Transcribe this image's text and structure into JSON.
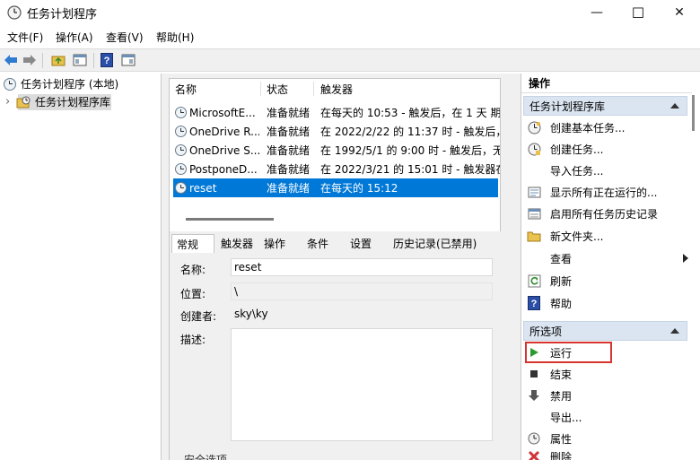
{
  "window": {
    "title": "任务计划程序",
    "minimize": "—",
    "maximize": "☐",
    "close": "✕"
  },
  "menu": [
    "文件(F)",
    "操作(A)",
    "查看(V)",
    "帮助(H)"
  ],
  "tree": {
    "root": "任务计划程序 (本地)",
    "child": "任务计划程序库",
    "expander": "›"
  },
  "list": {
    "headers": {
      "name": "名称",
      "status": "状态",
      "trigger": "触发器"
    },
    "rows": [
      {
        "name": "MicrosoftE...",
        "status": "准备就绪",
        "trigger": "在每天的 10:53 - 触发后，在 1 天 期"
      },
      {
        "name": "OneDrive R...",
        "status": "准备就绪",
        "trigger": "在 2022/2/22 的 11:37 时 - 触发后，"
      },
      {
        "name": "OneDrive S...",
        "status": "准备就绪",
        "trigger": "在 1992/5/1 的 9:00 时 - 触发后，无"
      },
      {
        "name": "PostponeD...",
        "status": "准备就绪",
        "trigger": "在 2022/3/21 的 15:01 时 - 触发器在"
      },
      {
        "name": "reset",
        "status": "准备就绪",
        "trigger": "在每天的 15:12"
      }
    ],
    "selected_index": 4
  },
  "tabs": [
    "常规",
    "触发器",
    "操作",
    "条件",
    "设置",
    "历史记录(已禁用)"
  ],
  "general": {
    "name_label": "名称:",
    "name_value": "reset",
    "location_label": "位置:",
    "location_value": "\\",
    "author_label": "创建者:",
    "author_value": "sky\\ky",
    "desc_label": "描述:",
    "desc_value": "",
    "security_label": "安全选项"
  },
  "actions": {
    "header": "操作",
    "section1": "任务计划程序库",
    "items1": [
      "创建基本任务...",
      "创建任务...",
      "导入任务...",
      "显示所有正在运行的...",
      "启用所有任务历史记录",
      "新文件夹...",
      "查看",
      "刷新",
      "帮助"
    ],
    "section2": "所选项",
    "items2": [
      "运行",
      "结束",
      "禁用",
      "导出...",
      "属性",
      "删除"
    ]
  }
}
